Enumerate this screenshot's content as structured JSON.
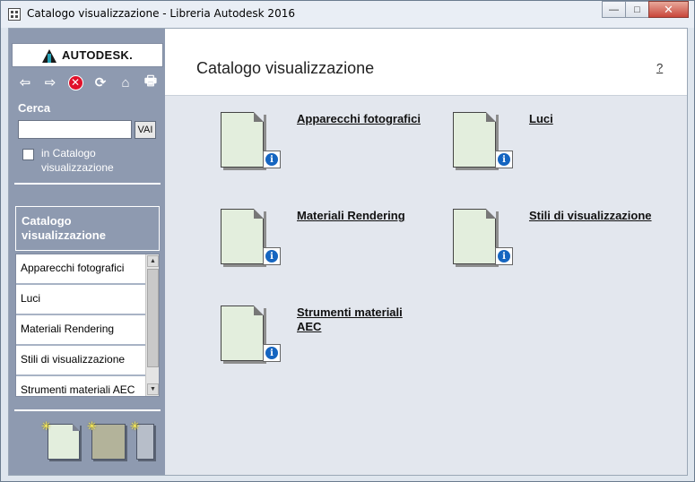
{
  "window": {
    "title": "Catalogo visualizzazione - Libreria Autodesk 2016",
    "minimize_glyph": "—",
    "maximize_glyph": "□",
    "close_glyph": "✕"
  },
  "sidebar": {
    "logo_text": "AUTODESK.",
    "toolbar": [
      {
        "name": "back-arrow-icon",
        "glyph": "⇦"
      },
      {
        "name": "forward-arrow-icon",
        "glyph": "⇨"
      },
      {
        "name": "stop-icon",
        "glyph": "✕"
      },
      {
        "name": "refresh-icon",
        "glyph": "⟳"
      },
      {
        "name": "home-icon",
        "glyph": "⌂"
      },
      {
        "name": "print-icon",
        "glyph": "🖶"
      }
    ],
    "search": {
      "label": "Cerca",
      "value": "",
      "placeholder": "",
      "go_label": "VAI",
      "scope_label": "in Catalogo visualizzazione",
      "scope_checked": false
    },
    "catalog_header": "Catalogo visualizzazione",
    "categories": [
      "Apparecchi fotografici",
      "Luci",
      "Materiali Rendering",
      "Stili di visualizzazione",
      "Strumenti materiali AEC"
    ],
    "scroll_up_glyph": "▲",
    "scroll_down_glyph": "▼",
    "spark_glyph": "✳"
  },
  "main": {
    "title": "Catalogo visualizzazione",
    "help_label": "?",
    "info_glyph": "i",
    "items": [
      {
        "label": "Apparecchi fotografici"
      },
      {
        "label": "Luci"
      },
      {
        "label": "Materiali Rendering"
      },
      {
        "label": "Stili di visualizzazione"
      },
      {
        "label": "Strumenti materiali AEC"
      }
    ]
  },
  "colors": {
    "sidebar_bg": "#8e9ab0",
    "main_bg": "#e3e7ee",
    "thumbnail_fill": "#e3eedd",
    "info_blue": "#1565c0",
    "stop_red": "#e0102a"
  }
}
